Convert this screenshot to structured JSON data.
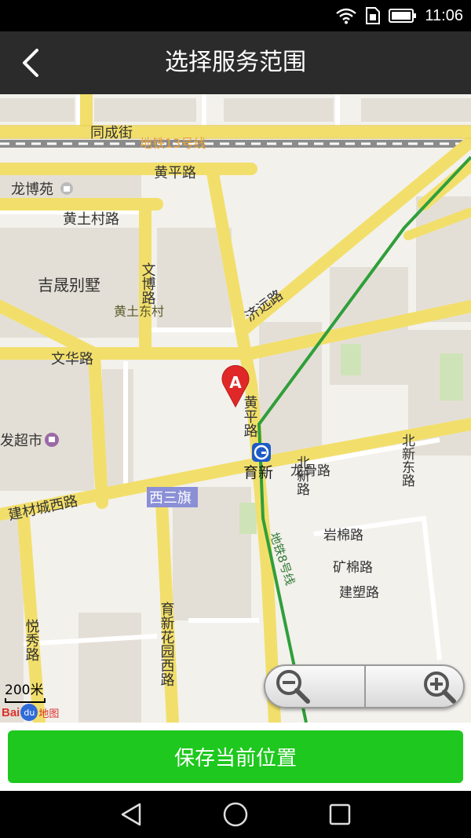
{
  "status_bar": {
    "time": "11:06",
    "icons": [
      "wifi-icon",
      "sim-icon",
      "battery-icon"
    ]
  },
  "title_bar": {
    "title": "选择服务范围",
    "back_icon": "chevron-left-icon"
  },
  "map": {
    "roads": {
      "tongcheng": "同成街",
      "huangping": "黄平路",
      "huangtucun": "黄土村路",
      "wenbo": "文博路",
      "jiyuan": "济远路",
      "wenhua": "文华路",
      "huangping_v": "黄平路",
      "jiancai": "建材城西路",
      "beixin": "北新路",
      "longgu": "龙骨路",
      "beixindong": "北新东路",
      "yanmian": "岩棉路",
      "kuangmian": "矿棉路",
      "jiansu": "建塑路",
      "yuexiu": "悦秀路",
      "yuxinhuayuan": "育新花园西路"
    },
    "places": {
      "longboyuan": "龙博苑",
      "jisheng": "吉晟别墅",
      "huangtudong": "黄土东村",
      "fachaoshi": "发超市",
      "xisanqi": "西三旗",
      "yuxin": "育新"
    },
    "metro_lines": {
      "line13": "地铁13号线",
      "line8": "地铁8号线"
    },
    "marker": {
      "letter": "A",
      "color": "#e02828"
    },
    "scale": "200米",
    "logo": {
      "bai": "Bai",
      "du": "du",
      "map": "地图"
    }
  },
  "bottom": {
    "save_label": "保存当前位置",
    "button_color": "#1ec81e"
  },
  "nav_bar": {
    "icons": [
      "back-triangle-icon",
      "home-circle-icon",
      "recents-square-icon"
    ]
  }
}
